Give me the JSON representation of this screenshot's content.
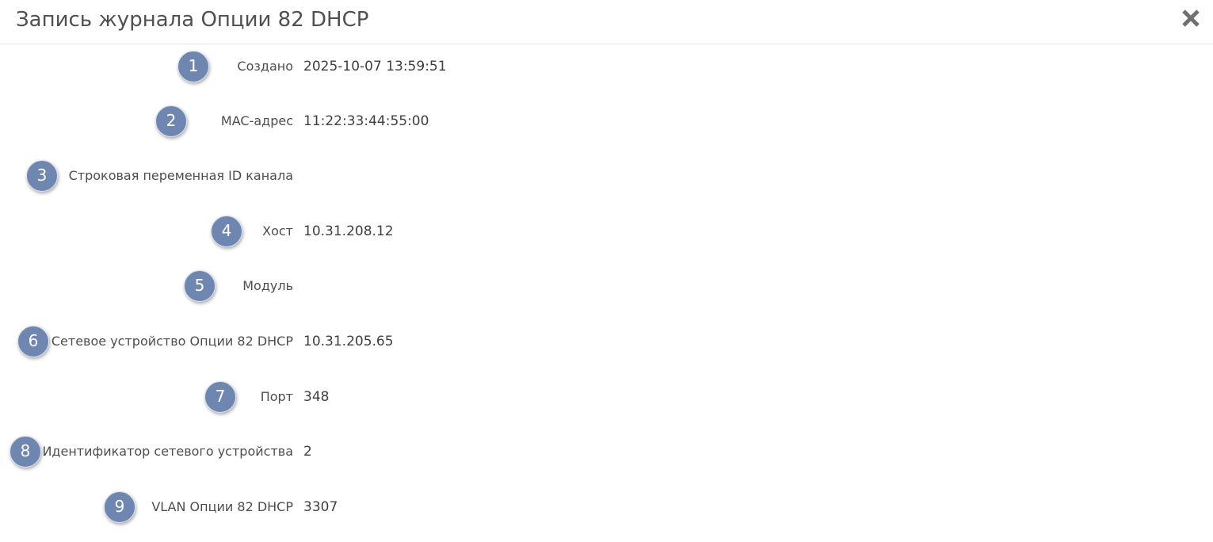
{
  "dialog": {
    "title": "Запись журнала Опции 82 DHCP",
    "close_icon": "close-icon"
  },
  "fields": [
    {
      "marker": "1",
      "label": "Создано",
      "value": "2025-10-07 13:59:51"
    },
    {
      "marker": "2",
      "label": "MAC-адрес",
      "value": "11:22:33:44:55:00"
    },
    {
      "marker": "3",
      "label": "Строковая переменная ID канала",
      "value": ""
    },
    {
      "marker": "4",
      "label": "Хост",
      "value": "10.31.208.12"
    },
    {
      "marker": "5",
      "label": "Модуль",
      "value": ""
    },
    {
      "marker": "6",
      "label": "Сетевое устройство Опции 82 DHCP",
      "value": "10.31.205.65"
    },
    {
      "marker": "7",
      "label": "Порт",
      "value": "348"
    },
    {
      "marker": "8",
      "label": "Идентификатор сетевого устройства",
      "value": "2"
    },
    {
      "marker": "9",
      "label": "VLAN Опции 82 DHCP",
      "value": "3307"
    }
  ],
  "colors": {
    "marker_fill": "#6f87b0",
    "title_text": "#505050",
    "close_icon": "#707070"
  }
}
